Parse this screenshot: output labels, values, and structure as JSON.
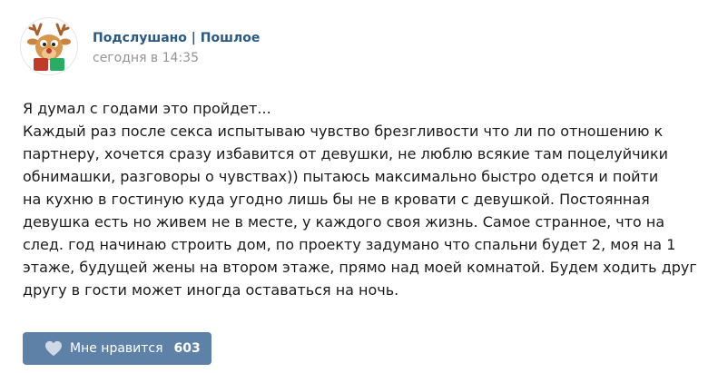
{
  "post": {
    "group_name": "Подслушано | Пошлое",
    "date": "сегодня в 14:35",
    "text_lines": [
      "Я думал с годами это пройдет...",
      "Каждый раз после секса испытываю чувство брезгливости что ли по отношению к",
      "партнеру, хочется сразу избавится от девушки, не люблю всякие там поцелуйчики",
      "обнимашки, разговоры о чувствах)) пытаюсь максимально быстро одется и пойти",
      "на кухню в гостиную куда угодно лишь бы не в кровати с девушкой. Постоянная",
      "девушка есть но живем не в месте, у каждого своя жизнь. Самое странное, что на",
      "след. год начинаю строить дом, по проекту задумано что спальни будет 2, моя на 1",
      "этаже, будущей жены на втором этаже, прямо над моей комнатой. Будем ходить друг",
      "другу в гости может иногда оставаться на ночь."
    ]
  },
  "like": {
    "label": "Мне нравится",
    "count": "603",
    "icon": "heart-icon"
  },
  "avatar": {
    "icon": "deer-mascot-icon"
  },
  "colors": {
    "link": "#2a5885",
    "date": "#939393",
    "like_button": "#5e81a8",
    "like_text": "#ffffff"
  }
}
